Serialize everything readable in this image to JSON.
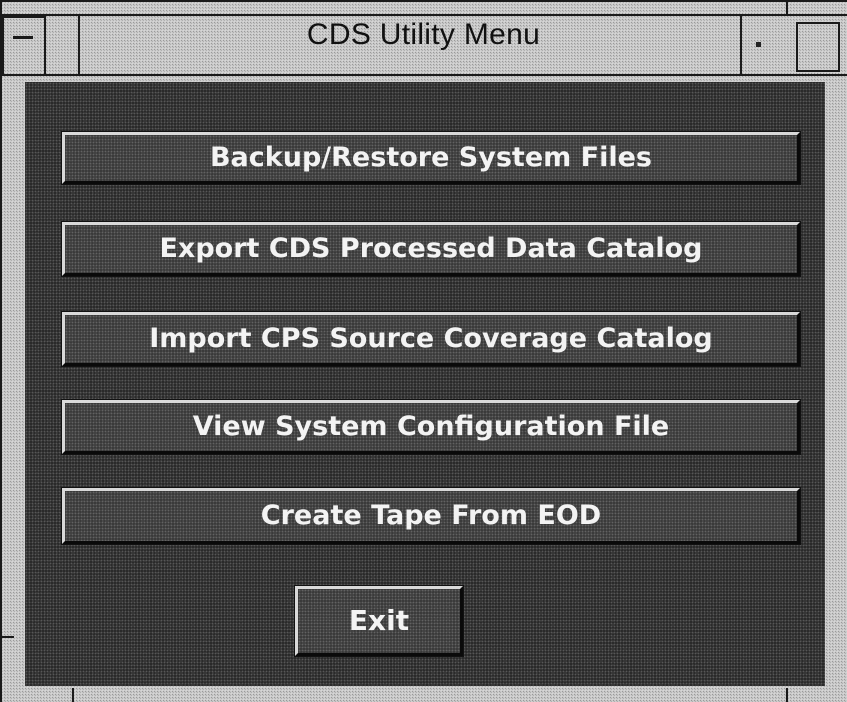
{
  "window": {
    "title": "CDS Utility Menu"
  },
  "menu": {
    "buttons": [
      "Backup/Restore System Files",
      "Export CDS Processed Data Catalog",
      "Import CPS Source Coverage Catalog",
      "View System Configuration File",
      "Create Tape From EOD"
    ],
    "exit_label": "Exit"
  }
}
